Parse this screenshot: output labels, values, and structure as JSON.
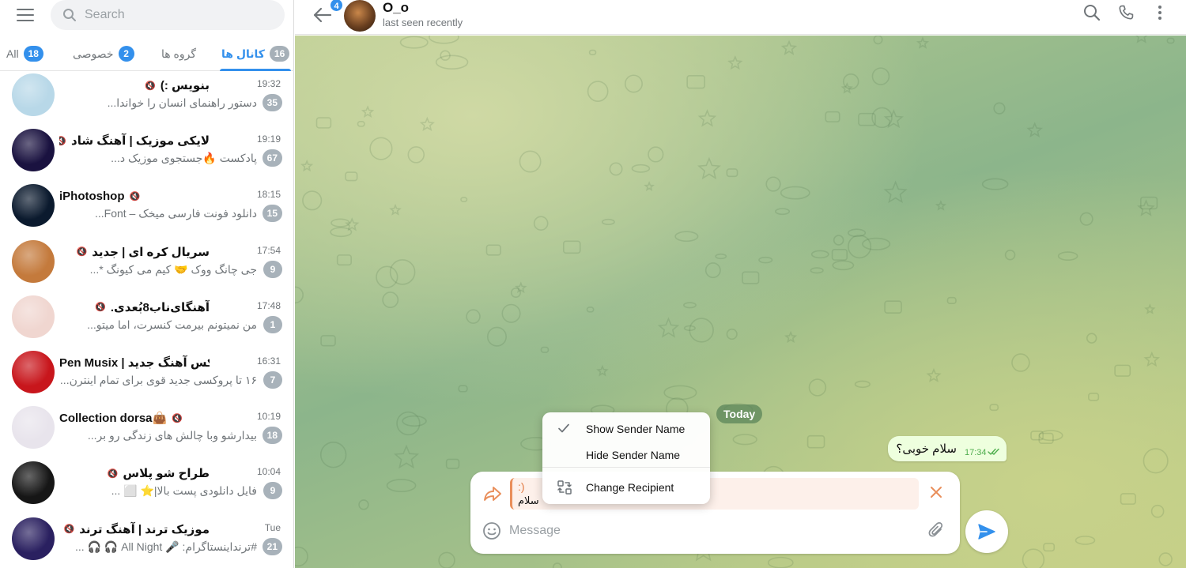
{
  "sidebar": {
    "search_placeholder": "Search",
    "folders": [
      {
        "label": "All",
        "count": "18",
        "active": false
      },
      {
        "label": "خصوصی",
        "count": "2",
        "active": false
      },
      {
        "label": "گروه ها",
        "count": "",
        "active": false
      },
      {
        "label": "کانال ها",
        "count": "16",
        "active": true
      }
    ],
    "chats": [
      {
        "name": "بنویس :)",
        "time": "19:32",
        "preview": "دستور راهنمای انسان را خواندا...",
        "unread": "35",
        "avatar_icon": "pencil-character-avatar",
        "avatar_color": "#b8d8e8"
      },
      {
        "name": "لایکی موزیک | آهنگ شاد",
        "time": "19:19",
        "preview": "پادکست 🔥جستجوی موزیک د...",
        "unread": "67",
        "avatar_icon": "neon-music-avatar",
        "avatar_color": "#1a1240"
      },
      {
        "name": "iPhotoshop",
        "time": "18:15",
        "preview": "دانلود فونت فارسی میخک – Font...",
        "unread": "15",
        "avatar_icon": "photoshop-logo-avatar",
        "avatar_color": "#0b1a2e"
      },
      {
        "name": "سریال کره ای | جدید",
        "time": "17:54",
        "preview": "جی چانگ ووک 🤝 کیم می کیونگ *...",
        "unread": "9",
        "avatar_icon": "drama-poster-avatar",
        "avatar_color": "#c47a3c"
      },
      {
        "name": "آهنگای‌ناب8بُعدی.",
        "time": "17:48",
        "preview": "من نمیتونم بیرمت کنسرت، اما میتو...",
        "unread": "1",
        "avatar_icon": "headphones-avatar",
        "avatar_color": "#f0d6d0"
      },
      {
        "name": "Pen Musix | ریمیکس آهنگ جدید",
        "time": "16:31",
        "preview": "۱۶ تا پروکسی جدید قوی برای تمام اینترن...",
        "unread": "7",
        "avatar_icon": "pen-musix-avatar",
        "avatar_color": "#c8161c"
      },
      {
        "name": "Collection dorsa👜",
        "time": "10:19",
        "preview": "بیدارشو وبا چالش های زندگی رو بر...",
        "unread": "18",
        "avatar_icon": "flower-sticker-avatar",
        "avatar_color": "#e8e4ec"
      },
      {
        "name": "طراح شو پلاس",
        "time": "10:04",
        "preview": "فایل دانلودی پست بالا|⭐ ⬜ ...",
        "unread": "9",
        "avatar_icon": "mehrab-logo-avatar",
        "avatar_color": "#161616"
      },
      {
        "name": "موزیک ترند | آهنگ ترند",
        "time": "Tue",
        "preview": "#ترنداینستاگرام: 🎤 All Night 🎧 🎧 ...",
        "unread": "21",
        "avatar_icon": "music-trend-avatar",
        "avatar_color": "#2a2060"
      }
    ]
  },
  "header": {
    "back_badge": "4",
    "peer_name": "O_o",
    "peer_status": "last seen recently",
    "icons": [
      "search-icon",
      "phone-icon",
      "more-vertical-icon"
    ]
  },
  "chat": {
    "date_pill": "Today",
    "message": {
      "text": "سلام خوبی؟",
      "time": "17:34",
      "status": "read"
    }
  },
  "composer": {
    "forward_line1": ":)",
    "forward_line2": "سلام",
    "placeholder": "Message"
  },
  "context_menu": {
    "items": [
      {
        "label": "Show Sender Name",
        "checked": true
      },
      {
        "label": "Hide Sender Name",
        "checked": false
      },
      {
        "label": "Change Recipient",
        "checked": false
      }
    ]
  },
  "colors": {
    "accent": "#3390ec",
    "bubble_out": "#eeffde",
    "forward_accent": "#e98e5a",
    "read_check": "#4fae4e"
  }
}
